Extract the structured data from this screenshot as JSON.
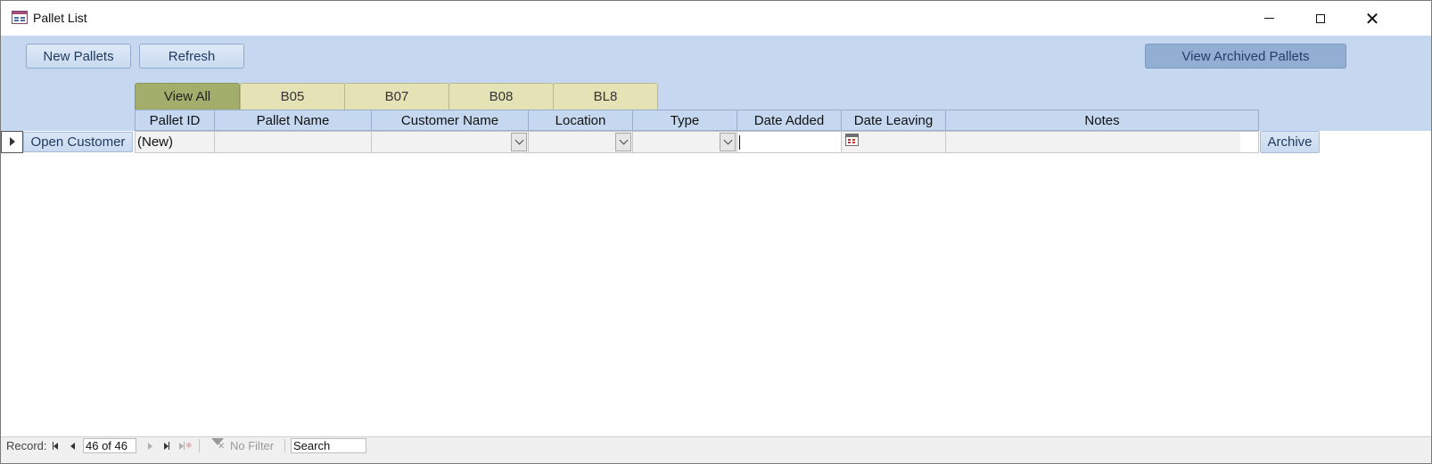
{
  "window": {
    "title": "Pallet List"
  },
  "toolbar": {
    "new_pallets": "New Pallets",
    "refresh": "Refresh",
    "view_archived": "View Archived Pallets"
  },
  "tabs": [
    {
      "label": "View All",
      "active": true
    },
    {
      "label": "B05",
      "active": false
    },
    {
      "label": "B07",
      "active": false
    },
    {
      "label": "B08",
      "active": false
    },
    {
      "label": "BL8",
      "active": false
    }
  ],
  "grid": {
    "columns": [
      "Pallet ID",
      "Pallet Name",
      "Customer Name",
      "Location",
      "Type",
      "Date Added",
      "Date Leaving",
      "Notes"
    ],
    "new_row": {
      "open_button": "Open Customer",
      "pallet_id": "(New)",
      "archive_button": "Archive"
    }
  },
  "statusbar": {
    "record_label": "Record:",
    "record_value": "46 of 46",
    "filter_label": "No Filter",
    "search_placeholder": "Search"
  },
  "colors": {
    "header_band": "#c5d8ef",
    "tab_active": "#a3ad6c",
    "tab_inactive": "#e5e3b6",
    "button_archived": "#93aed3"
  }
}
